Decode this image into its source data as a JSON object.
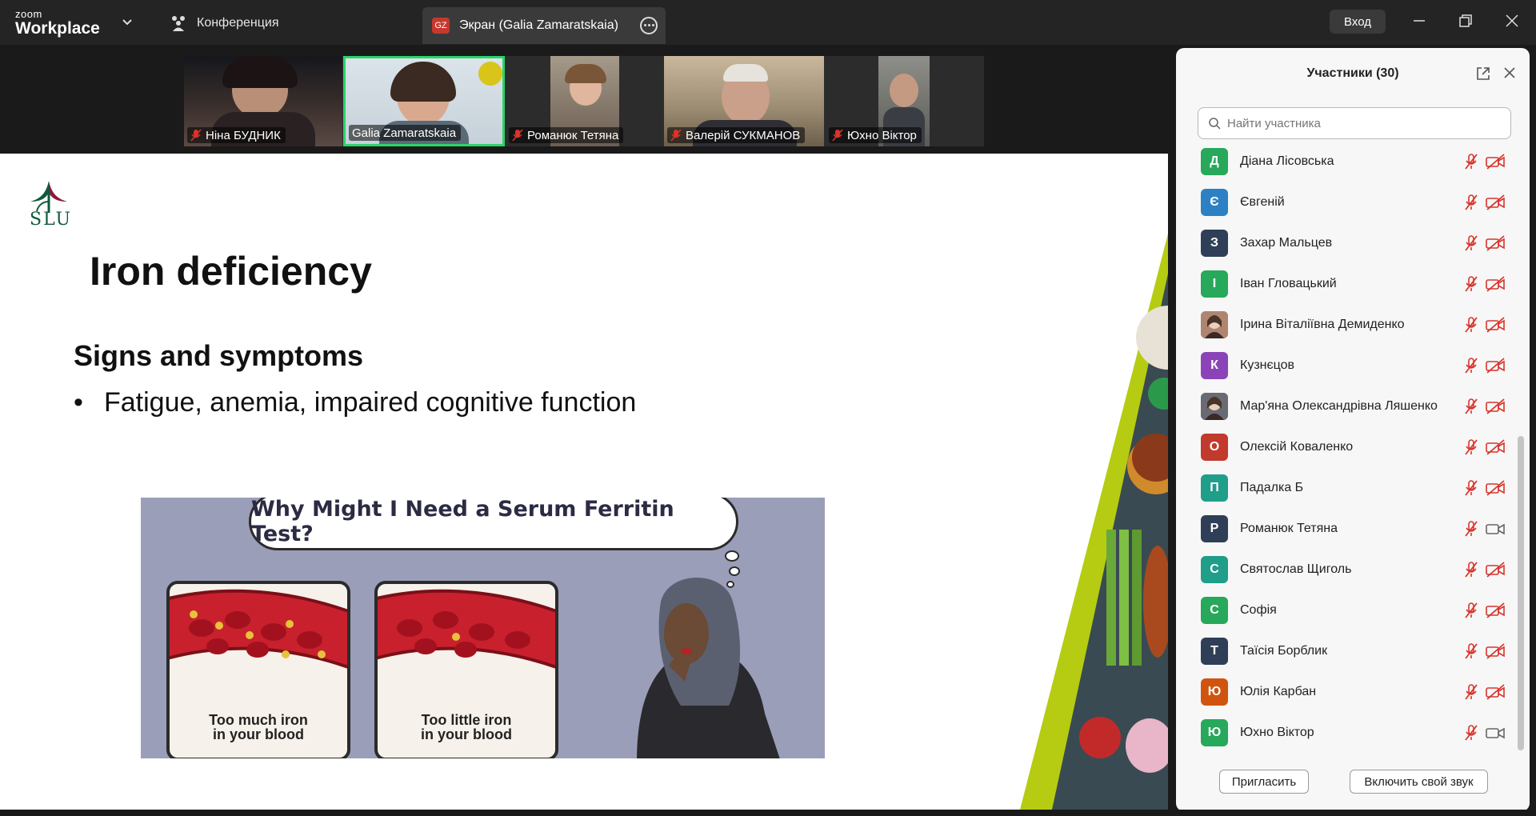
{
  "app": {
    "logo_small": "zoom",
    "logo_big": "Workplace"
  },
  "tabs": {
    "meeting": "Конференция",
    "share_badge": "GZ",
    "share": "Экран (Galia Zamaratskaia)"
  },
  "header": {
    "signin": "Вход"
  },
  "video_tiles": [
    {
      "name": "Ніна БУДНИК"
    },
    {
      "name": "Galia Zamaratskaia"
    },
    {
      "name": "Романюк Тетяна"
    },
    {
      "name": "Валерій СУКМАНОВ"
    },
    {
      "name": "Юхно Віктор"
    }
  ],
  "slide": {
    "logo": "SLU",
    "title": "Iron deficiency",
    "subtitle": "Signs and symptoms",
    "bullet_mark": "•",
    "bullet": "Fatigue, anemia, impaired cognitive function",
    "illustration": {
      "question": "Why Might I Need a Serum Ferritin Test?",
      "caption_left_1": "Too much iron",
      "caption_left_2": "in your blood",
      "caption_right_1": "Too little iron",
      "caption_right_2": "in your blood"
    }
  },
  "participants": {
    "title": "Участники (30)",
    "search_placeholder": "Найти участника",
    "list": [
      {
        "initial": "Д",
        "name": "Діана Лісовська",
        "color": "#27a85b",
        "cam_on": false
      },
      {
        "initial": "Є",
        "name": "Євгеній",
        "color": "#2d80c4",
        "cam_on": false
      },
      {
        "initial": "З",
        "name": "Захар Мальцев",
        "color": "#2f3f57",
        "cam_on": false
      },
      {
        "initial": "І",
        "name": "Іван Гловацький",
        "color": "#27a85b",
        "cam_on": false
      },
      {
        "initial": "",
        "name": "Ірина Віталіївна Демиденко",
        "color": "#b08570",
        "cam_on": false,
        "photo": true
      },
      {
        "initial": "К",
        "name": "Кузнєцов",
        "color": "#8b44b8",
        "cam_on": false
      },
      {
        "initial": "",
        "name": "Мар'яна Олександрівна Ляшенко",
        "color": "#6a6a72",
        "cam_on": false,
        "photo": true
      },
      {
        "initial": "О",
        "name": "Олексій Коваленко",
        "color": "#c23a2c",
        "cam_on": false
      },
      {
        "initial": "П",
        "name": "Падалка Б",
        "color": "#1f9e8a",
        "cam_on": false
      },
      {
        "initial": "Р",
        "name": "Романюк Тетяна",
        "color": "#2f3f57",
        "cam_on": true
      },
      {
        "initial": "С",
        "name": "Святослав Щиголь",
        "color": "#1f9e8a",
        "cam_on": false
      },
      {
        "initial": "С",
        "name": "Софія",
        "color": "#27a85b",
        "cam_on": false
      },
      {
        "initial": "Т",
        "name": "Таїсія Борблик",
        "color": "#2f3f57",
        "cam_on": false
      },
      {
        "initial": "Ю",
        "name": "Юлія Карбан",
        "color": "#d0540f",
        "cam_on": false
      },
      {
        "initial": "Ю",
        "name": "Юхно Віктор",
        "color": "#27a85b",
        "cam_on": true
      }
    ],
    "invite": "Пригласить",
    "unmute_me": "Включить свой звук"
  },
  "colors": {
    "active_speaker": "#2bd46a",
    "mic_muted": "#d9342b",
    "slide_green": "#b5cc12"
  }
}
